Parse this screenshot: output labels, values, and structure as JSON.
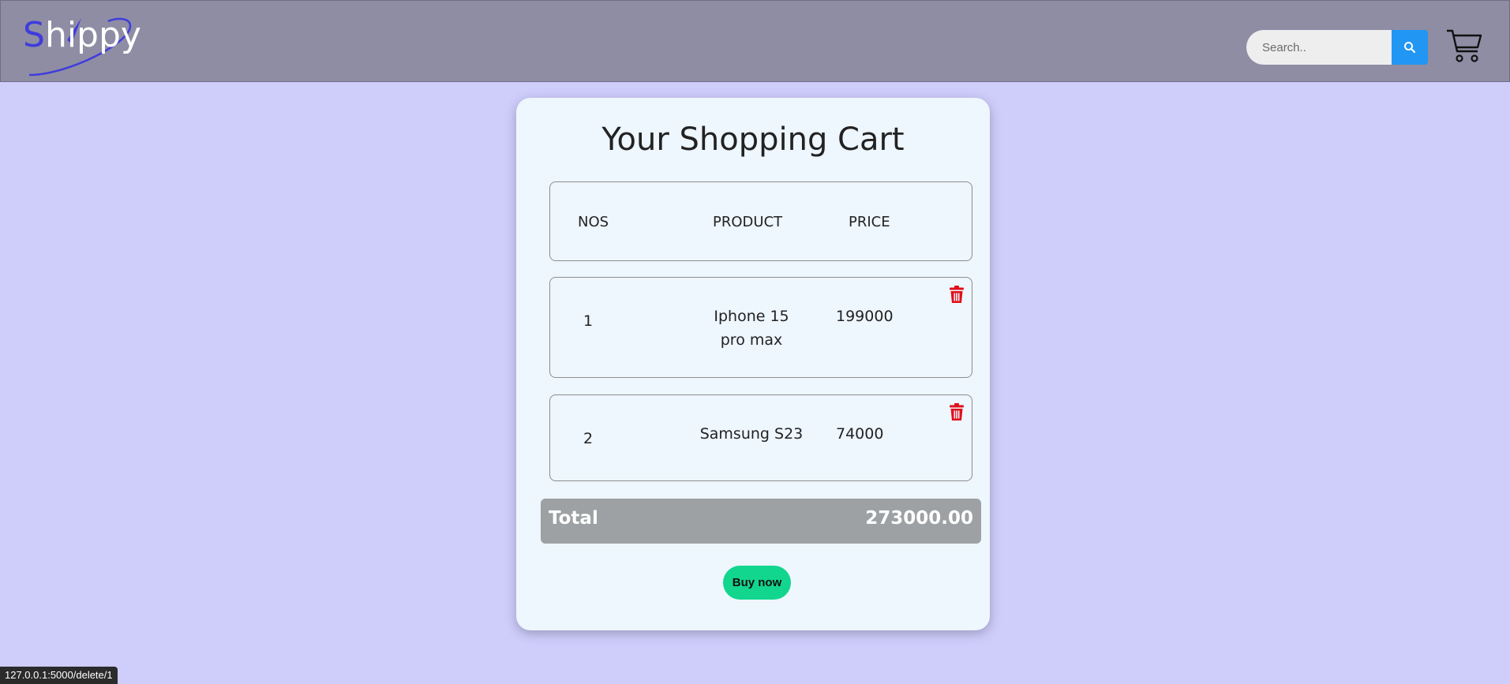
{
  "navbar": {
    "logo_text": "hippy",
    "logo_initial": "S",
    "search": {
      "placeholder": "Search..",
      "value": ""
    },
    "icons": {
      "search": "search-icon",
      "cart": "cart-icon"
    }
  },
  "cart": {
    "title": "Your Shopping Cart",
    "headers": {
      "nos": "NOS",
      "product": "PRODUCT",
      "price": "PRICE"
    },
    "items": [
      {
        "nos": "1",
        "product_line1": "Iphone 15",
        "product_line2": "pro max",
        "price": "199000",
        "delete_icon": "trash-icon"
      },
      {
        "nos": "2",
        "product_line1": "Samsung S23",
        "product_line2": "",
        "price": "74000",
        "delete_icon": "trash-icon"
      }
    ],
    "total_label": "Total",
    "total_value": "273000.00",
    "buy_label": "Buy now"
  },
  "status_bar": {
    "url": "127.0.0.1:5000/delete/1"
  },
  "colors": {
    "navbar_bg": "#8e8da4",
    "page_bg": "#cfcdfa",
    "card_bg": "#eef6fe",
    "search_button": "#2196f3",
    "trash": "#e0101a",
    "total_bar": "#9da1a3",
    "buy_button": "#12d68e"
  }
}
